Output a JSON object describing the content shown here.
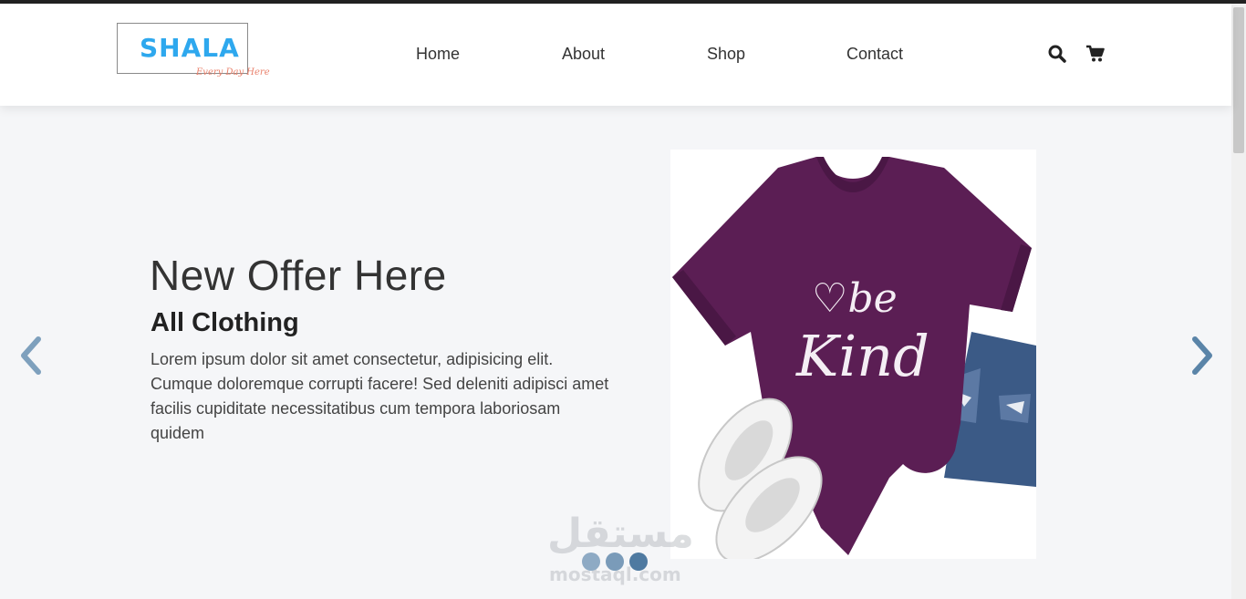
{
  "brand": {
    "name": "SHALA",
    "tagline": "Every Day Here",
    "primary_color": "#2ea8ee",
    "tagline_color": "#e9806b"
  },
  "nav": {
    "items": [
      {
        "label": "Home"
      },
      {
        "label": "About"
      },
      {
        "label": "Shop"
      },
      {
        "label": "Contact"
      }
    ],
    "icons": [
      "search-icon",
      "cart-icon"
    ]
  },
  "hero": {
    "title": "New Offer Here",
    "subtitle": "All Clothing",
    "description": "Lorem ipsum dolor sit amet consectetur, adipisicing elit. Cumque doloremque corrupti facere! Sed deleniti adipisci amet facilis cupiditate necessitatibus cum tempora laboriosam quidem",
    "image": {
      "shirt_text": "be Kind",
      "shirt_color": "#5b1e54"
    }
  },
  "carousel": {
    "prev_icon": "chevron-left-icon",
    "next_icon": "chevron-right-icon",
    "arrow_color": "#6f8eaa",
    "active_index": 2,
    "dot_count": 3
  },
  "watermark": {
    "arabic": "مستقل",
    "latin": "mostaql.com"
  }
}
